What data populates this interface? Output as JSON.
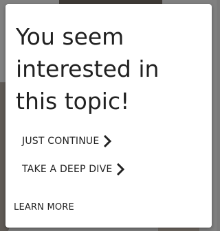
{
  "dialog": {
    "headline": "You seem interested in this topic!",
    "actions": [
      {
        "label": "JUST CONTINUE",
        "icon": "chevron-right-icon"
      },
      {
        "label": "TAKE A DEEP DIVE",
        "icon": "chevron-right-icon"
      }
    ],
    "learn_more": "LEARN MORE"
  },
  "colors": {
    "card_background": "#ffffff",
    "text": "#212121",
    "overlay": "#808080"
  }
}
